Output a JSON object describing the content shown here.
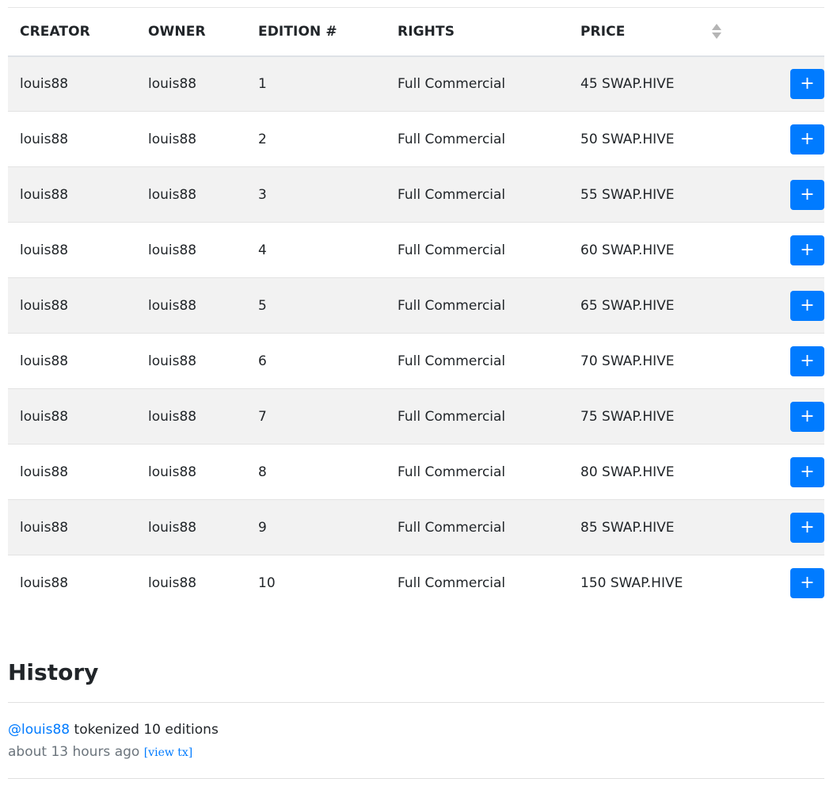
{
  "table": {
    "headers": {
      "creator": "CREATOR",
      "owner": "OWNER",
      "edition": "EDITION #",
      "rights": "RIGHTS",
      "price": "PRICE"
    },
    "add_label": "+",
    "rows": [
      {
        "creator": "louis88",
        "owner": "louis88",
        "edition": "1",
        "rights": "Full Commercial",
        "price": "45 SWAP.HIVE"
      },
      {
        "creator": "louis88",
        "owner": "louis88",
        "edition": "2",
        "rights": "Full Commercial",
        "price": "50 SWAP.HIVE"
      },
      {
        "creator": "louis88",
        "owner": "louis88",
        "edition": "3",
        "rights": "Full Commercial",
        "price": "55 SWAP.HIVE"
      },
      {
        "creator": "louis88",
        "owner": "louis88",
        "edition": "4",
        "rights": "Full Commercial",
        "price": "60 SWAP.HIVE"
      },
      {
        "creator": "louis88",
        "owner": "louis88",
        "edition": "5",
        "rights": "Full Commercial",
        "price": "65 SWAP.HIVE"
      },
      {
        "creator": "louis88",
        "owner": "louis88",
        "edition": "6",
        "rights": "Full Commercial",
        "price": "70 SWAP.HIVE"
      },
      {
        "creator": "louis88",
        "owner": "louis88",
        "edition": "7",
        "rights": "Full Commercial",
        "price": "75 SWAP.HIVE"
      },
      {
        "creator": "louis88",
        "owner": "louis88",
        "edition": "8",
        "rights": "Full Commercial",
        "price": "80 SWAP.HIVE"
      },
      {
        "creator": "louis88",
        "owner": "louis88",
        "edition": "9",
        "rights": "Full Commercial",
        "price": "85 SWAP.HIVE"
      },
      {
        "creator": "louis88",
        "owner": "louis88",
        "edition": "10",
        "rights": "Full Commercial",
        "price": "150 SWAP.HIVE"
      }
    ]
  },
  "history": {
    "title": "History",
    "entries": [
      {
        "user": "@louis88",
        "action": " tokenized 10 editions",
        "time": "about 13 hours ago",
        "link": "[view tx]"
      }
    ]
  },
  "icons": {
    "sort": "sort-icon"
  },
  "colors": {
    "accent": "#007bff",
    "stripe": "#f2f2f2"
  }
}
